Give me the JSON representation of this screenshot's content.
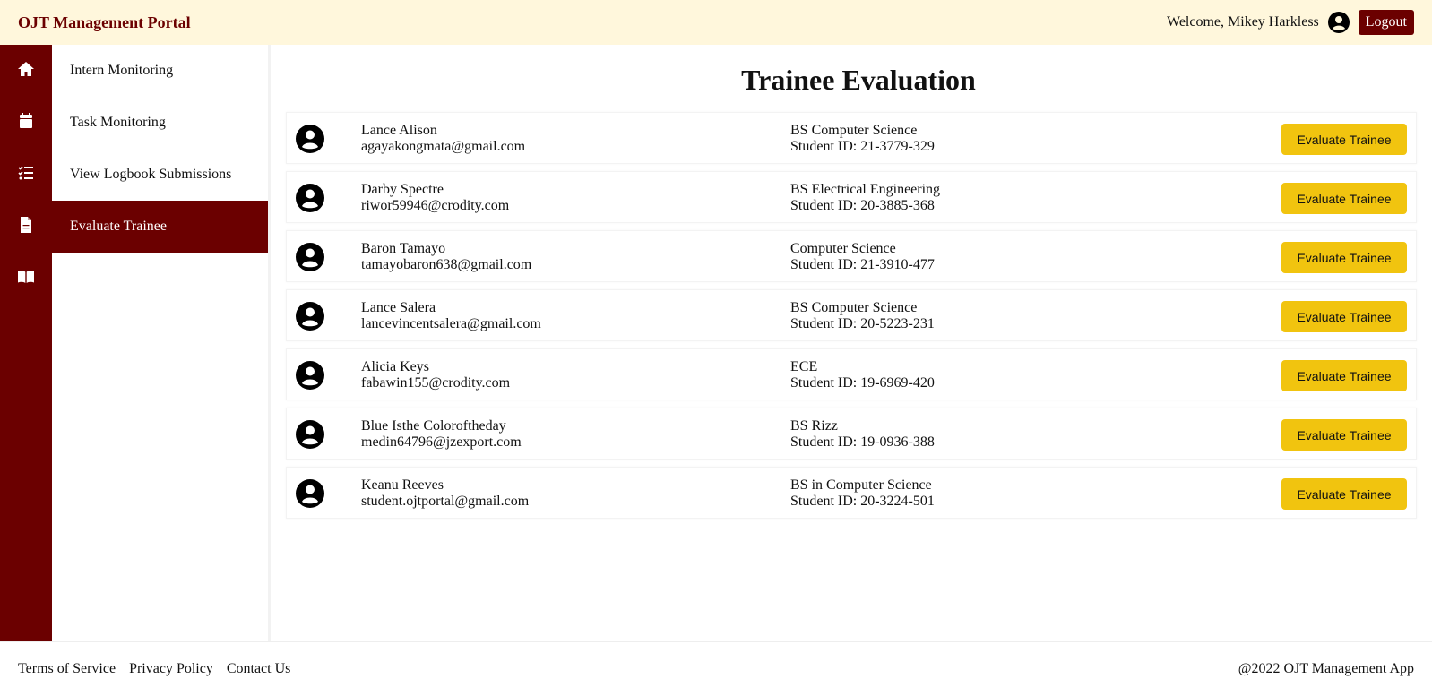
{
  "header": {
    "brand": "OJT Management Portal",
    "welcome": "Welcome, Mikey Harkless",
    "logout_label": "Logout"
  },
  "rail": {
    "icons": [
      "home-icon",
      "calendar-icon",
      "checklist-icon",
      "document-icon",
      "book-icon"
    ]
  },
  "sidebar": {
    "items": [
      {
        "label": "Intern Monitoring"
      },
      {
        "label": "Task Monitoring"
      },
      {
        "label": "View Logbook Submissions"
      },
      {
        "label": "Evaluate Trainee"
      }
    ],
    "active_index": 3
  },
  "main": {
    "title": "Trainee Evaluation",
    "button_label": "Evaluate Trainee",
    "trainees": [
      {
        "name": "Lance Alison",
        "email": "agayakongmata@gmail.com",
        "program": "BS Computer Science",
        "student_id": "Student ID: 21-3779-329"
      },
      {
        "name": "Darby Spectre",
        "email": "riwor59946@crodity.com",
        "program": "BS Electrical Engineering",
        "student_id": "Student ID: 20-3885-368"
      },
      {
        "name": "Baron Tamayo",
        "email": "tamayobaron638@gmail.com",
        "program": "Computer Science",
        "student_id": "Student ID: 21-3910-477"
      },
      {
        "name": "Lance Salera",
        "email": "lancevincentsalera@gmail.com",
        "program": "BS Computer Science",
        "student_id": "Student ID: 20-5223-231"
      },
      {
        "name": "Alicia Keys",
        "email": "fabawin155@crodity.com",
        "program": "ECE",
        "student_id": "Student ID: 19-6969-420"
      },
      {
        "name": "Blue Isthe Coloroftheday",
        "email": "medin64796@jzexport.com",
        "program": "BS Rizz",
        "student_id": "Student ID: 19-0936-388"
      },
      {
        "name": "Keanu Reeves",
        "email": "student.ojtportal@gmail.com",
        "program": "BS in Computer Science",
        "student_id": "Student ID: 20-3224-501"
      }
    ]
  },
  "footer": {
    "links": [
      "Terms of Service",
      "Privacy Policy",
      "Contact Us"
    ],
    "copyright": "@2022 OJT Management App"
  },
  "colors": {
    "brand": "#6b0000",
    "header_bg": "#fff7dc",
    "button_yellow": "#f1c40f"
  }
}
